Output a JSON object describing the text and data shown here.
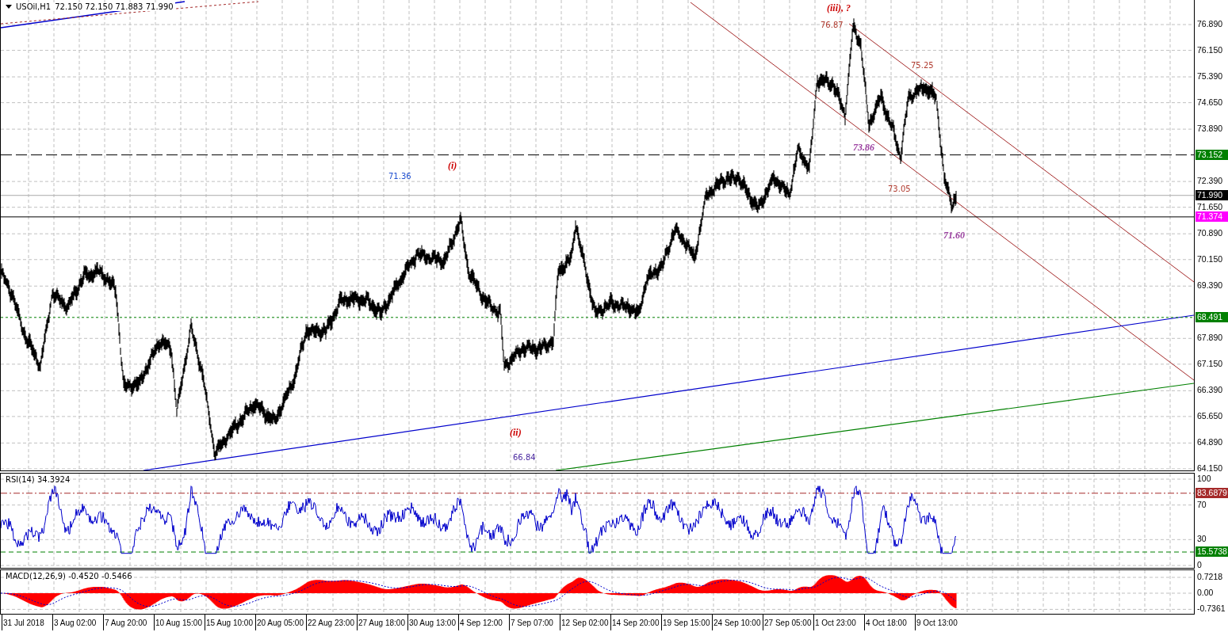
{
  "header": {
    "symbol": "USOil,H1",
    "quotes": "72.150 72.150 71.883 71.990"
  },
  "price_axis": {
    "ticks": [
      "76.890",
      "76.150",
      "75.390",
      "74.650",
      "73.890",
      "72.390",
      "71.650",
      "70.890",
      "70.150",
      "69.390",
      "67.890",
      "67.150",
      "66.390",
      "65.650",
      "64.890",
      "64.150"
    ]
  },
  "price_tags": [
    {
      "text": "73.152",
      "color": "#008000"
    },
    {
      "text": "71.990",
      "color": "#000000"
    },
    {
      "text": "71.374",
      "color": "#ff00ff"
    },
    {
      "text": "68.491",
      "color": "#008000"
    }
  ],
  "annotations": [
    {
      "text": "(iii), ?",
      "kind": "wave",
      "color": "#cc0000"
    },
    {
      "text": "76.87",
      "kind": "price",
      "color": "#b03a2e"
    },
    {
      "text": "75.25",
      "kind": "price",
      "color": "#b03a2e"
    },
    {
      "text": "73.86",
      "kind": "projection",
      "color": "#9b3fa0"
    },
    {
      "text": "73.05",
      "kind": "price",
      "color": "#b03a2e"
    },
    {
      "text": "71.60",
      "kind": "projection",
      "color": "#9b3fa0"
    },
    {
      "text": "71.36",
      "kind": "price",
      "color": "#1f4fd0"
    },
    {
      "text": "(i)",
      "kind": "wave",
      "color": "#cc0000"
    },
    {
      "text": "(ii)",
      "kind": "wave",
      "color": "#cc0000"
    },
    {
      "text": "66.84",
      "kind": "price",
      "color": "#4b2aa0"
    }
  ],
  "rsi": {
    "label": "RSI(14) 34.3924",
    "ticks": [
      "100",
      "70",
      "30",
      "0"
    ],
    "tags": [
      {
        "text": "83.6879",
        "color": "#a52a2a"
      },
      {
        "text": "15.5738",
        "color": "#008000"
      }
    ]
  },
  "macd": {
    "label": "MACD(12,26,9) -0.4520 -0.5466",
    "ticks": [
      "0.7218",
      "0.00",
      "-0.7361"
    ]
  },
  "time_axis": {
    "labels": [
      "31 Jul 2018",
      "3 Aug 02:00",
      "7 Aug 20:00",
      "10 Aug 15:00",
      "15 Aug 10:00",
      "20 Aug 05:00",
      "22 Aug 23:00",
      "27 Aug 18:00",
      "30 Aug 13:00",
      "4 Sep 12:00",
      "7 Sep 07:00",
      "12 Sep 02:00",
      "14 Sep 20:00",
      "19 Sep 15:00",
      "24 Sep 10:00",
      "27 Sep 05:00",
      "1 Oct 23:00",
      "4 Oct 18:00",
      "9 Oct 13:00"
    ]
  }
}
